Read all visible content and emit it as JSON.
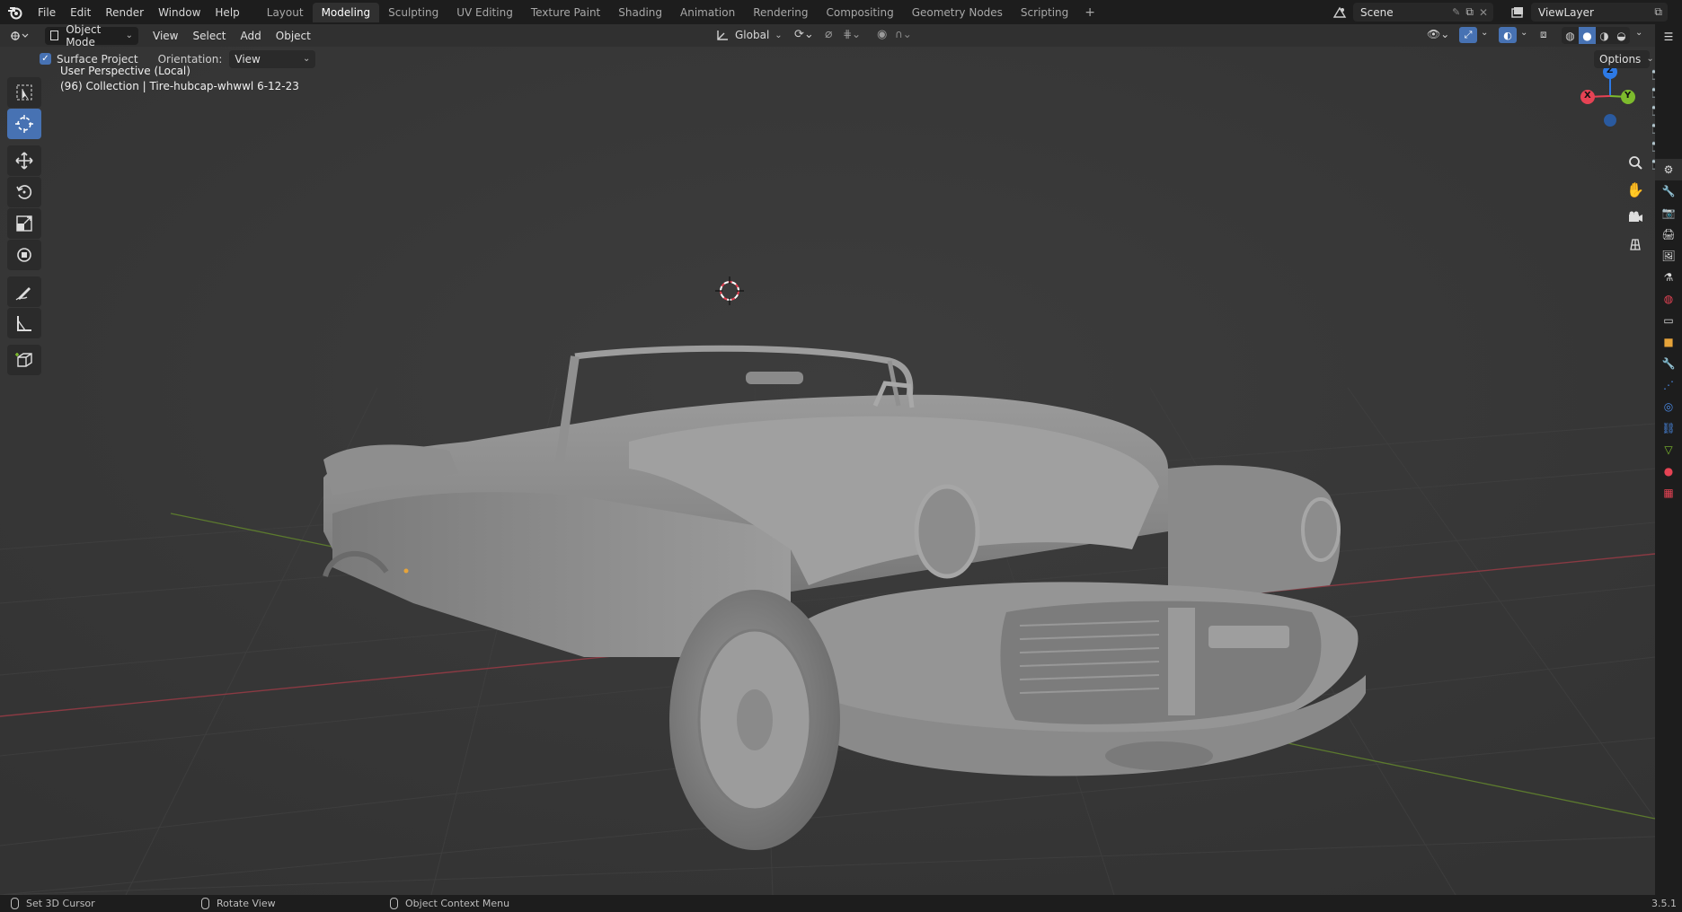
{
  "topbar": {
    "menus": [
      "File",
      "Edit",
      "Render",
      "Window",
      "Help"
    ],
    "tabs": [
      "Layout",
      "Modeling",
      "Sculpting",
      "UV Editing",
      "Texture Paint",
      "Shading",
      "Animation",
      "Rendering",
      "Compositing",
      "Geometry Nodes",
      "Scripting"
    ],
    "active_tab": "Modeling",
    "add_tab": "+",
    "scene": "Scene",
    "view_layer": "ViewLayer"
  },
  "header": {
    "mode": "Object Mode",
    "menus": [
      "View",
      "Select",
      "Add",
      "Object"
    ],
    "transform_orientation": "Global"
  },
  "tool_settings": {
    "surface_project_label": "Surface Project",
    "surface_project_checked": true,
    "orientation_label": "Orientation:",
    "orientation_value": "View",
    "options_label": "Options"
  },
  "viewport": {
    "perspective": "User Perspective (Local)",
    "collection_info": "(96) Collection | Tire-hubcap-whwwl  6-12-23",
    "background_color": "#393939",
    "gizmo": {
      "x": "X",
      "y": "Y",
      "z": "Z"
    },
    "axis_colors": {
      "x": "#e64354",
      "y": "#7dbb2d",
      "z": "#2d7ae6"
    }
  },
  "statusbar": {
    "left": "Set 3D Cursor",
    "middle": "Rotate View",
    "right": "Object Context Menu",
    "version": "3.5.1"
  },
  "colors": {
    "accent": "#4772b3",
    "panel": "#303030",
    "topbar": "#1d1d1d"
  }
}
